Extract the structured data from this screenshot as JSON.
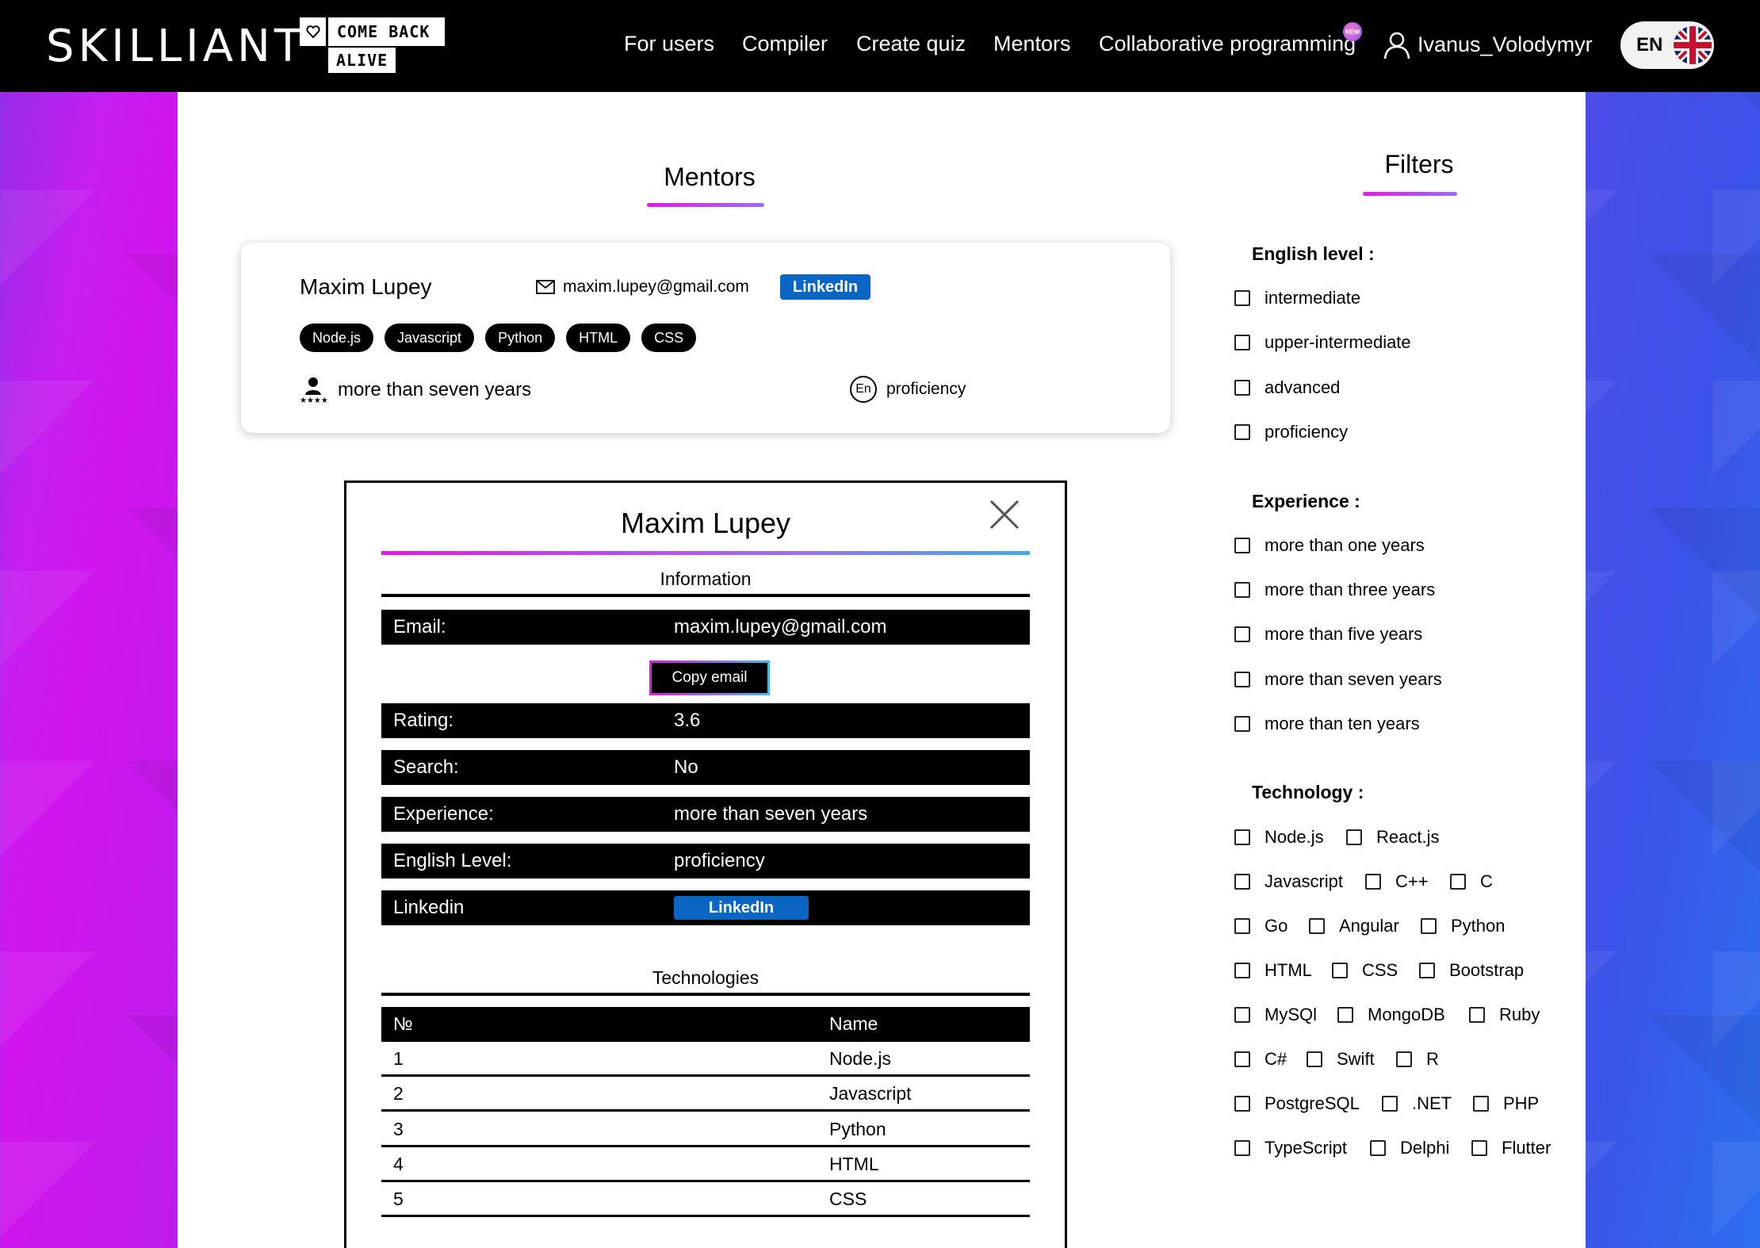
{
  "nav": {
    "logo": "SKILLIANT",
    "cba_top": "COME BACK",
    "cba_bottom": "ALIVE",
    "links": [
      "For users",
      "Compiler",
      "Create quiz",
      "Mentors",
      "Collaborative programming"
    ],
    "new_badge": "NEW",
    "user_name": "Ivanus_Volodymyr",
    "lang": "EN"
  },
  "mentors_title": "Mentors",
  "filters_title": "Filters",
  "card": {
    "name": "Maxim Lupey",
    "email": "maxim.lupey@gmail.com",
    "linkedin": "LinkedIn",
    "tags": [
      "Node.js",
      "Javascript",
      "Python",
      "HTML",
      "CSS"
    ],
    "experience": "more than seven years",
    "english_icon": "En",
    "english": "proficiency"
  },
  "modal": {
    "title": "Maxim Lupey",
    "info_title": "Information",
    "email_label": "Email:",
    "email_value": "maxim.lupey@gmail.com",
    "copy_button": "Copy email",
    "rating_label": "Rating:",
    "rating_value": "3.6",
    "search_label": "Search:",
    "search_value": "No",
    "experience_label": "Experience:",
    "experience_value": "more than seven years",
    "english_label": "English Level:",
    "english_value": "proficiency",
    "linkedin_label": "Linkedin",
    "linkedin_button": "LinkedIn",
    "tech_title": "Technologies",
    "tech_col_num": "№",
    "tech_col_name": "Name",
    "tech_rows": [
      {
        "num": "1",
        "name": "Node.js"
      },
      {
        "num": "2",
        "name": "Javascript"
      },
      {
        "num": "3",
        "name": "Python"
      },
      {
        "num": "4",
        "name": "HTML"
      },
      {
        "num": "5",
        "name": "CSS"
      }
    ]
  },
  "filters": {
    "english_head": "English level :",
    "english_options": [
      "intermediate",
      "upper-intermediate",
      "advanced",
      "proficiency"
    ],
    "experience_head": "Experience :",
    "experience_options": [
      "more than one years",
      "more than three years",
      "more than five years",
      "more than seven years",
      "more than ten years"
    ],
    "technology_head": "Technology :",
    "technology_options": [
      [
        "Node.js",
        "React.js"
      ],
      [
        "Javascript",
        "C++",
        "C"
      ],
      [
        "Go",
        "Angular",
        "Python"
      ],
      [
        "HTML",
        "CSS",
        "Bootstrap"
      ],
      [
        "MySQl",
        "MongoDB",
        "Ruby"
      ],
      [
        "C#",
        "Swift",
        "R"
      ],
      [
        "PostgreSQL",
        ".NET",
        "PHP"
      ],
      [
        "TypeScript",
        "Delphi",
        "Flutter"
      ]
    ]
  },
  "colors": {
    "accent_pink": "#e11be6",
    "accent_purple": "#9f6df0",
    "linkedin_blue": "#0a66c2"
  }
}
